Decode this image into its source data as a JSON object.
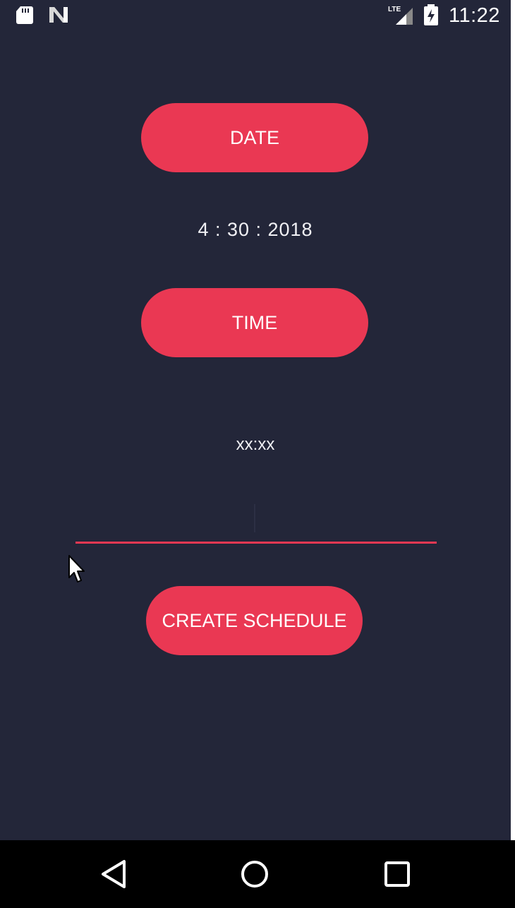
{
  "status_bar": {
    "time": "11:22",
    "network": "LTE",
    "icons": [
      "sd-card-icon",
      "n-logo-icon",
      "lte-signal-icon",
      "battery-charging-icon"
    ]
  },
  "main": {
    "date_button_label": "DATE",
    "date_value": "4 : 30 : 2018",
    "time_button_label": "TIME",
    "time_value": "xx:xx",
    "input_value": "",
    "create_button_label": "CREATE SCHEDULE"
  },
  "nav_bar": {
    "icons": [
      "back-icon",
      "home-icon",
      "recents-icon"
    ]
  },
  "colors": {
    "background": "#232639",
    "accent": "#ea3853",
    "text": "#ffffff",
    "nav_background": "#000000"
  }
}
